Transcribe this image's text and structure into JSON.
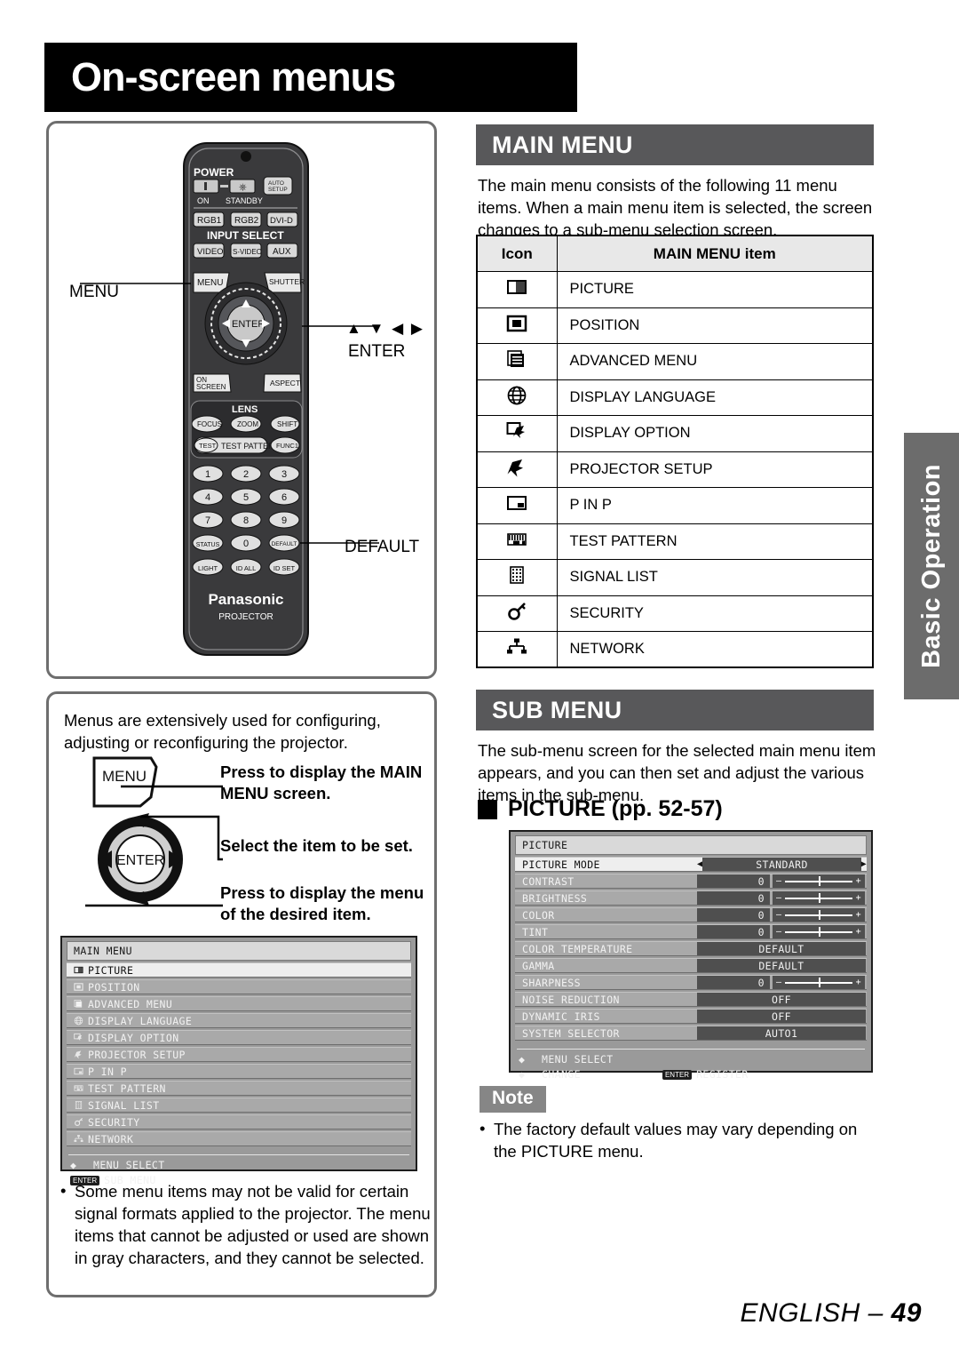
{
  "page": {
    "title": "On-screen menus",
    "footer_language": "ENGLISH –",
    "footer_page": "49",
    "side_tab": "Basic Operation"
  },
  "remote_panel": {
    "callouts": {
      "menu": "MENU",
      "arrows": "▲ ▼ ◀ ▶",
      "enter": "ENTER",
      "default": "DEFAULT"
    },
    "remote": {
      "power_label": "POWER",
      "power_on": "ON",
      "power_standby": "STANDBY",
      "auto_setup": "AUTO SETUP",
      "input_select": "INPUT SELECT",
      "input_buttons_row1": [
        "RGB1",
        "RGB2",
        "DVI-D"
      ],
      "input_buttons_row2": [
        "VIDEO",
        "S-VIDEO",
        "AUX"
      ],
      "menu_button": "MENU",
      "shutter_button": "SHUTTER",
      "enter_button": "ENTER",
      "on_screen_button": "ON SCREEN",
      "aspect_button": "ASPECT",
      "lens_label": "LENS",
      "lens_buttons": [
        "FOCUS",
        "ZOOM",
        "SHIFT"
      ],
      "test_button": "TEST",
      "test_pattern_label": "TEST PATTERN",
      "func1_button": "FUNC1",
      "numpad": [
        "1",
        "2",
        "3",
        "4",
        "5",
        "6",
        "7",
        "8",
        "9"
      ],
      "status_button": "STATUS",
      "zero_button": "0",
      "default_button": "DEFAULT",
      "light_button": "LIGHT",
      "id_all_button": "ID ALL",
      "id_set_button": "ID SET",
      "brand": "Panasonic",
      "sub_brand": "PROJECTOR"
    }
  },
  "flow_panel": {
    "intro": "Menus are extensively used for configuring, adjusting or reconfiguring the projector.",
    "menu_key_label": "MENU",
    "enter_key_label": "ENTER",
    "steps": [
      "Press to display the MAIN MENU screen.",
      "Select the item to be set.",
      "Press to display the menu of the desired item."
    ],
    "bottom_note": "Some menu items may not be valid for certain signal formats applied to the projector. The menu items that cannot be adjusted or used are shown in gray characters, and they cannot be selected."
  },
  "main_menu_section": {
    "header": "MAIN MENU",
    "paragraph": "The main menu consists of the following 11 menu items. When a main menu item is selected, the screen changes to a sub-menu selection screen.",
    "table": {
      "headers": [
        "Icon",
        "MAIN MENU item"
      ],
      "rows": [
        {
          "icon": "picture-icon",
          "label": "PICTURE"
        },
        {
          "icon": "position-icon",
          "label": "POSITION"
        },
        {
          "icon": "advanced-menu-icon",
          "label": "ADVANCED MENU"
        },
        {
          "icon": "globe-icon",
          "label": "DISPLAY LANGUAGE"
        },
        {
          "icon": "display-option-icon",
          "label": "DISPLAY OPTION"
        },
        {
          "icon": "projector-setup-icon",
          "label": "PROJECTOR SETUP"
        },
        {
          "icon": "p-in-p-icon",
          "label": "P IN P"
        },
        {
          "icon": "test-pattern-icon",
          "label": "TEST PATTERN"
        },
        {
          "icon": "signal-list-icon",
          "label": "SIGNAL LIST"
        },
        {
          "icon": "key-icon",
          "label": "SECURITY"
        },
        {
          "icon": "network-icon",
          "label": "NETWORK"
        }
      ]
    }
  },
  "sub_menu_section": {
    "header": "SUB MENU",
    "paragraph": "The sub-menu screen for the selected main menu item appears, and you can then set and adjust the various items in the sub-menu.",
    "picture_heading": "PICTURE (pp. 52-57)"
  },
  "osd_main_menu": {
    "title": "MAIN MENU",
    "items": [
      {
        "label": "PICTURE",
        "selected": true
      },
      {
        "label": "POSITION",
        "selected": false
      },
      {
        "label": "ADVANCED MENU",
        "selected": false
      },
      {
        "label": "DISPLAY LANGUAGE",
        "selected": false
      },
      {
        "label": "DISPLAY OPTION",
        "selected": false
      },
      {
        "label": "PROJECTOR SETUP",
        "selected": false
      },
      {
        "label": "P IN P",
        "selected": false
      },
      {
        "label": "TEST PATTERN",
        "selected": false
      },
      {
        "label": "SIGNAL LIST",
        "selected": false
      },
      {
        "label": "SECURITY",
        "selected": false
      },
      {
        "label": "NETWORK",
        "selected": false
      }
    ],
    "footer": {
      "select_label": "MENU SELECT",
      "enter_key": "ENTER",
      "enter_label": "SUB MENU"
    }
  },
  "osd_picture": {
    "title": "PICTURE",
    "mode_row": {
      "label": "PICTURE MODE",
      "value": "STANDARD",
      "left_arrow": "◀",
      "right_arrow": "▶"
    },
    "rows": [
      {
        "label": "CONTRAST",
        "value": "0",
        "slider": true
      },
      {
        "label": "BRIGHTNESS",
        "value": "0",
        "slider": true
      },
      {
        "label": "COLOR",
        "value": "0",
        "slider": true
      },
      {
        "label": "TINT",
        "value": "0",
        "slider": true
      },
      {
        "label": "COLOR TEMPERATURE",
        "value": "DEFAULT",
        "slider": false
      },
      {
        "label": "GAMMA",
        "value": "DEFAULT",
        "slider": false
      },
      {
        "label": "SHARPNESS",
        "value": "0",
        "slider": true
      },
      {
        "label": "NOISE REDUCTION",
        "value": "OFF",
        "slider": false
      },
      {
        "label": "DYNAMIC IRIS",
        "value": "OFF",
        "slider": false
      },
      {
        "label": "SYSTEM SELECTOR",
        "value": "AUTO1",
        "slider": false
      }
    ],
    "footer": {
      "select_label": "MENU SELECT",
      "change_label": "CHANGE",
      "enter_key": "ENTER",
      "enter_label": "REGISTER"
    }
  },
  "note": {
    "badge": "Note",
    "text": "The factory default values may vary depending on the PICTURE menu."
  },
  "colors": {
    "header_gray": "#58585a",
    "tab_gray": "#6c6c6c",
    "note_gray": "#868686",
    "box_border": "#6e6e6e"
  }
}
